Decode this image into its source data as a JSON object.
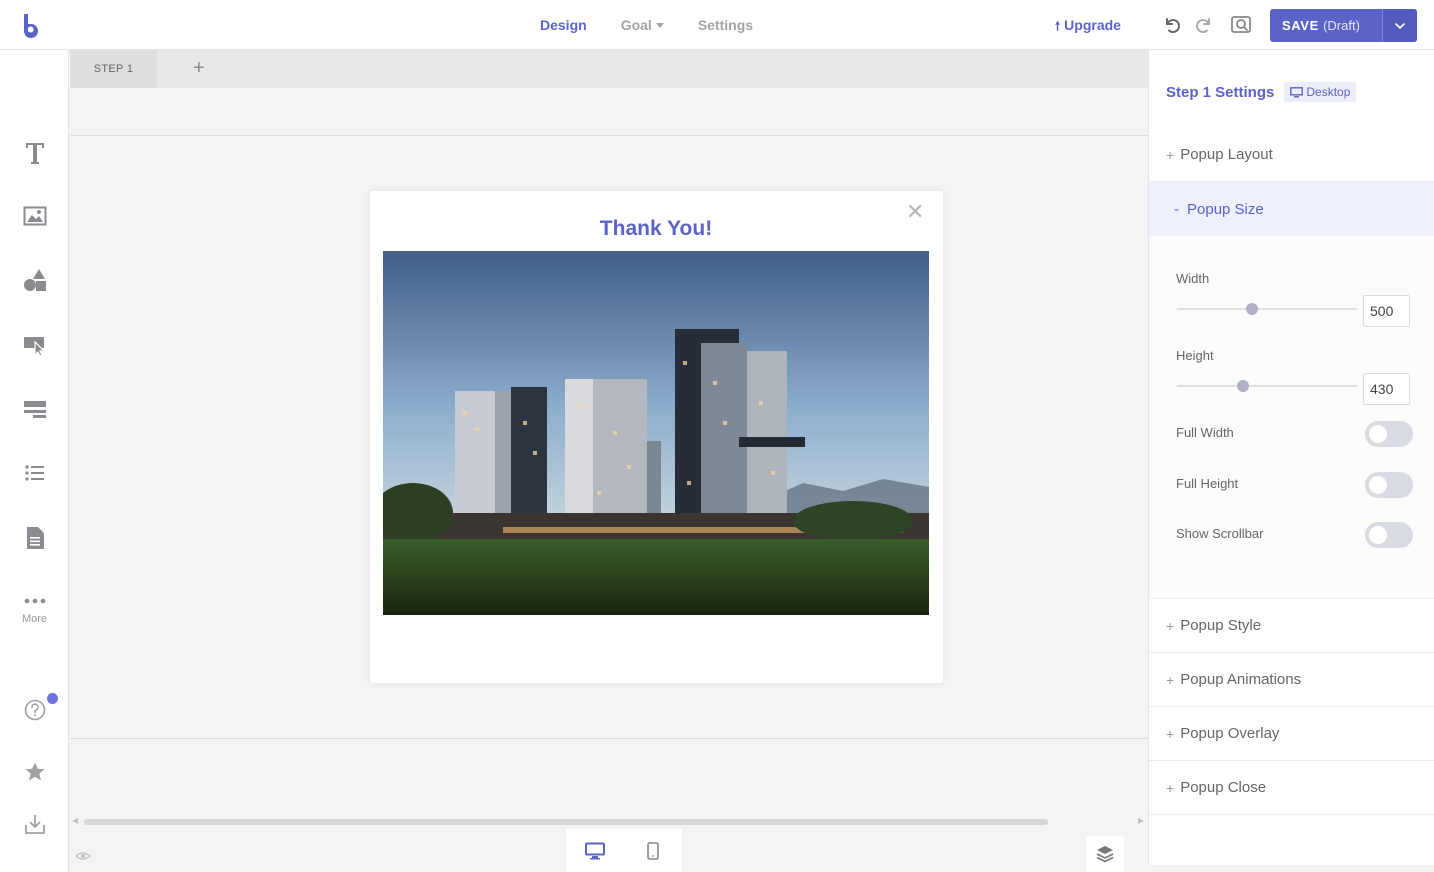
{
  "topbar": {
    "nav_design": "Design",
    "nav_goal": "Goal",
    "nav_settings": "Settings",
    "upgrade_label": "Upgrade",
    "save_label": "SAVE",
    "save_state": "(Draft)"
  },
  "leftbar": {
    "more_label": "More"
  },
  "steps": {
    "step1_label": "STEP 1",
    "add_label": "+"
  },
  "popup": {
    "title": "Thank You!",
    "close_glyph": "✕"
  },
  "panel": {
    "title": "Step 1 Settings",
    "device_badge": "Desktop",
    "sections": {
      "layout": "Popup Layout",
      "size": "Popup Size",
      "style": "Popup Style",
      "animations": "Popup Animations",
      "overlay": "Popup Overlay",
      "close": "Popup Close"
    },
    "size": {
      "width_label": "Width",
      "width_value": "500",
      "height_label": "Height",
      "height_value": "430",
      "full_width_label": "Full Width",
      "full_height_label": "Full Height",
      "show_scrollbar_label": "Show Scrollbar"
    }
  },
  "colors": {
    "accent": "#5b63c9"
  }
}
